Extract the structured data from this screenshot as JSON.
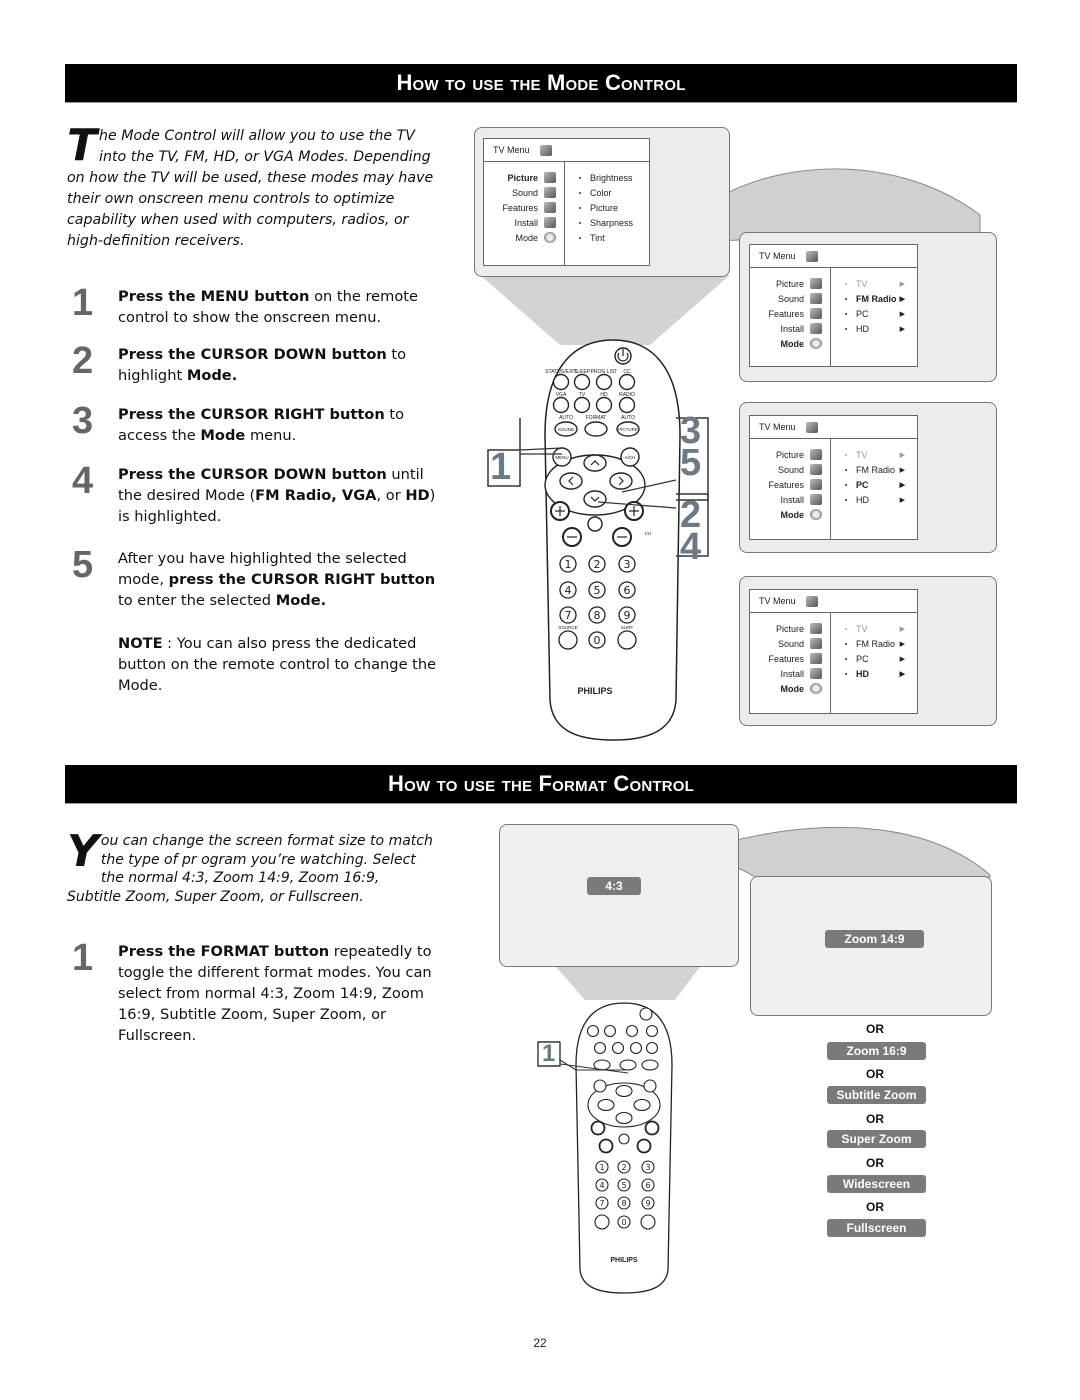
{
  "page_number": "22",
  "mode_section": {
    "title": "How to use the Mode Control",
    "intro_dropcap": "T",
    "intro_text": "he Mode Control will allow you to use the TV into the TV, FM, HD, or VGA Modes. Depending on how the TV will be used, these modes may have their own onscreen menu controls to optimize capability when used with computers, radios, or high-definition receivers.",
    "steps": [
      {
        "num": "1",
        "bold": "Press the MENU button",
        "rest": " on the remote control to show the onscreen menu."
      },
      {
        "num": "2",
        "bold": "Press the CURSOR DOWN button",
        "rest": " to highlight ",
        "bold2": "Mode."
      },
      {
        "num": "3",
        "bold": "Press the CURSOR RIGHT button",
        "rest": " to access the ",
        "bold2": "Mode",
        "rest2": " menu."
      },
      {
        "num": "4",
        "bold": "Press the CURSOR DOWN button",
        "rest": " until the desired Mode (",
        "bold2": "FM Radio, VGA",
        "rest2": ", or ",
        "bold3": "HD",
        "rest3": ") is highlighted."
      },
      {
        "num": "5",
        "pre": "After you have highlighted the selected mode, ",
        "bold": "press the CURSOR RIGHT button",
        "rest": " to enter the selected ",
        "bold2": "Mode."
      }
    ],
    "note_label": "NOTE",
    "note_text": " : You can also press the dedicated button on the remote control to change the Mode.",
    "menus": [
      {
        "title": "TV Menu",
        "left_items": [
          "Picture",
          "Sound",
          "Features",
          "Install",
          "Mode"
        ],
        "left_bold_index": 0,
        "right_items": [
          "Brightness",
          "Color",
          "Picture",
          "Sharpness",
          "Tint"
        ],
        "right_arrows": false
      },
      {
        "title": "TV Menu",
        "left_items": [
          "Picture",
          "Sound",
          "Features",
          "Install",
          "Mode"
        ],
        "left_bold_index": 4,
        "right_items": [
          "TV",
          "FM Radio",
          "PC",
          "HD"
        ],
        "right_highlight": "FM Radio",
        "right_arrows": true
      },
      {
        "title": "TV Menu",
        "left_items": [
          "Picture",
          "Sound",
          "Features",
          "Install",
          "Mode"
        ],
        "left_bold_index": 4,
        "right_items": [
          "TV",
          "FM Radio",
          "PC",
          "HD"
        ],
        "right_highlight": "PC",
        "right_arrows": true
      },
      {
        "title": "TV Menu",
        "left_items": [
          "Picture",
          "Sound",
          "Features",
          "Install",
          "Mode"
        ],
        "left_bold_index": 4,
        "right_items": [
          "TV",
          "FM Radio",
          "PC",
          "HD"
        ],
        "right_highlight": "HD",
        "right_arrows": true
      }
    ],
    "callouts": [
      "1",
      "3",
      "5",
      "2",
      "4"
    ]
  },
  "format_section": {
    "title": "How to use the Format Control",
    "intro_dropcap": "Y",
    "intro_text": "ou can change the screen format size to match the type of pr ogram you’re watching. Select the normal 4:3, Zoom 14:9, Zoom 16:9, Subtitle Zoom, Super Zoom, or Fullscreen.",
    "step": {
      "num": "1",
      "bold": "Press the FORMAT button",
      "rest": " repeatedly to toggle the different format modes. You can select from normal 4:3, Zoom 14:9, Zoom 16:9, Subtitle Zoom, Super Zoom, or Fullscreen."
    },
    "screen1_label": "4:3",
    "screen2_label": "Zoom 14:9",
    "or_label": "OR",
    "options": [
      "Zoom 16:9",
      "Subtitle Zoom",
      "Super Zoom",
      "Widescreen",
      "Fullscreen"
    ],
    "callout": "1"
  },
  "remote": {
    "brand": "PHILIPS",
    "top_row": [
      "STATUS/EXIT",
      "SLEEP",
      "PROG.LIST",
      "CC"
    ],
    "second_row": [
      "VGA",
      "TV",
      "HD",
      "RADIO"
    ],
    "third_row": [
      "AUTO SOUND",
      "FORMAT",
      "AUTO PICTURE"
    ],
    "menu": "MENU",
    "ach": "A/CH",
    "digits": [
      "1",
      "2",
      "3",
      "4",
      "5",
      "6",
      "7",
      "8",
      "9",
      "0"
    ],
    "source": "SOURCE",
    "surf": "SURF",
    "ch": "CH"
  },
  "colors": {
    "section_bar": "#000000",
    "step_number": "#666666",
    "callout_number": "#6b7b85",
    "format_label": "#7a7a7a",
    "screen_bg": "#ececec"
  }
}
